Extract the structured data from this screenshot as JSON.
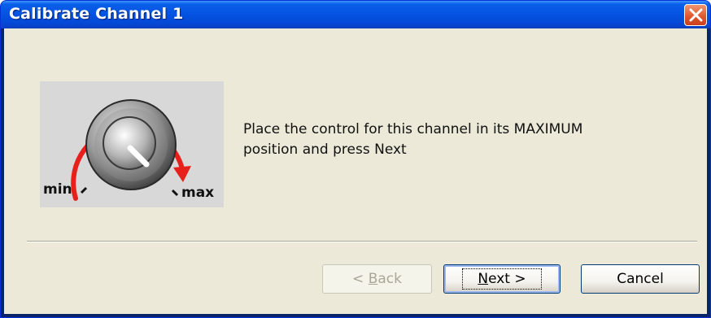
{
  "window": {
    "title": "Calibrate Channel 1",
    "close_icon": "close-x-icon"
  },
  "illustration": {
    "min_label": "min",
    "max_label": "max",
    "arrow_color": "#e8201b",
    "icon": "rotary-knob-icon"
  },
  "instruction": "Place the control for this channel in its MAXIMUM position and press Next",
  "buttons": {
    "back": {
      "prefix": "< ",
      "mnemonic": "B",
      "rest": "ack",
      "enabled": false
    },
    "next": {
      "mnemonic": "N",
      "rest": "ext >",
      "default": true
    },
    "cancel": {
      "label": "Cancel"
    }
  }
}
